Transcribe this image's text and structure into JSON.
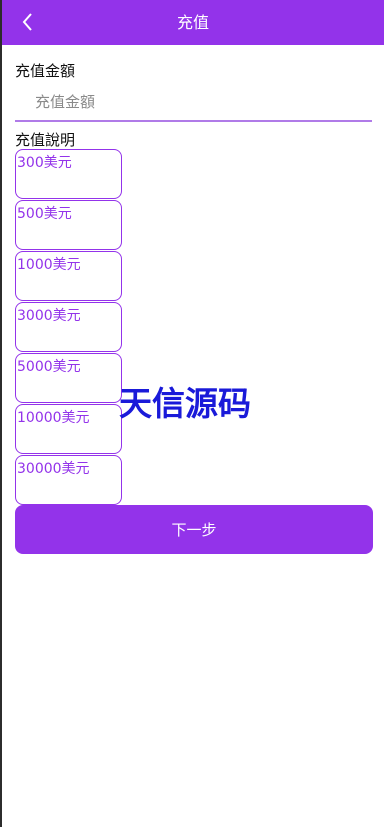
{
  "header": {
    "title": "充值"
  },
  "form": {
    "amount_label": "充值金額",
    "amount_placeholder": "充值金額",
    "description_label": "充值說明"
  },
  "options": [
    "300美元",
    "500美元",
    "1000美元",
    "3000美元",
    "5000美元",
    "10000美元",
    "30000美元"
  ],
  "watermark": "天信源码",
  "actions": {
    "next_label": "下一步"
  },
  "colors": {
    "accent": "#9333ea",
    "watermark": "#1a1ad9"
  }
}
